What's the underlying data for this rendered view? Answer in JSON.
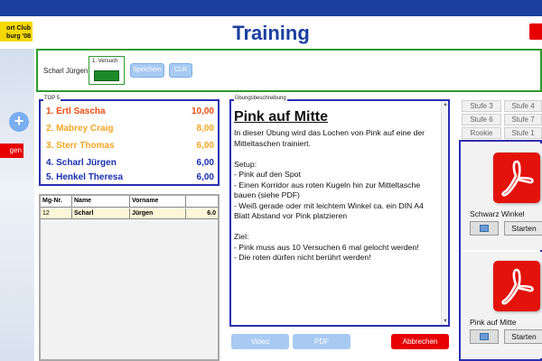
{
  "app": {
    "title": "Training",
    "logo_line1": "ort Club",
    "logo_line2": "burg '08",
    "sidebar_red_label": "gen"
  },
  "session": {
    "player_name": "Scharl Jürgen",
    "versuch_label": "1. Versuch",
    "save_label": "Speichern",
    "clr_label": "CLR"
  },
  "top5": {
    "label": "TOP 5",
    "rows": [
      {
        "rank": "1.",
        "name": "Ertl Sascha",
        "score": "10,00",
        "color": "#f04b10"
      },
      {
        "rank": "2.",
        "name": "Mabrey Craig",
        "score": "8,00",
        "color": "#f5a623"
      },
      {
        "rank": "3.",
        "name": "Sterr Thomas",
        "score": "6,00",
        "color": "#f5a623"
      },
      {
        "rank": "4.",
        "name": "Scharl Jürgen",
        "score": "6,00",
        "color": "#1a2fb0"
      },
      {
        "rank": "5.",
        "name": "Henkel Theresa",
        "score": "6,00",
        "color": "#1a2fb0"
      }
    ]
  },
  "grid": {
    "headers": [
      "Mg-Nr.",
      "Name",
      "Vorname",
      ""
    ],
    "rows": [
      [
        "12",
        "Scharl",
        "Jürgen",
        "6.0"
      ]
    ]
  },
  "description": {
    "label": "Übungsbeschreibung",
    "title": "Pink auf Mitte",
    "text": "In dieser Übung wird das Lochen von Pink auf eine der Mitteltaschen trainiert.\n\nSetup:\n- Pink auf den Spot\n- Einen Korridor aus roten Kugeln hin zur Mitteltasche bauen (siehe PDF)\n- Weiß gerade oder mit leichtem Winkel ca. ein DIN A4 Blatt Abstand vor Pink platzieren\n\nZiel:\n- Pink muss aus 10 Versuchen 6 mal gelocht werden!\n- Die roten dürfen nicht berührt werden!"
  },
  "buttons": {
    "video": "Video",
    "pdf": "PDF",
    "abbrechen": "Abbrechen"
  },
  "stufen": [
    "Stufe 3",
    "Stufe 4",
    "Stufe 6",
    "Stufe 7",
    "Rookie",
    "Stufe 1"
  ],
  "pdfs": [
    {
      "name": "Schwarz Winkel",
      "start": "Starten"
    },
    {
      "name": "Pink auf Mitte",
      "start": "Starten"
    }
  ]
}
